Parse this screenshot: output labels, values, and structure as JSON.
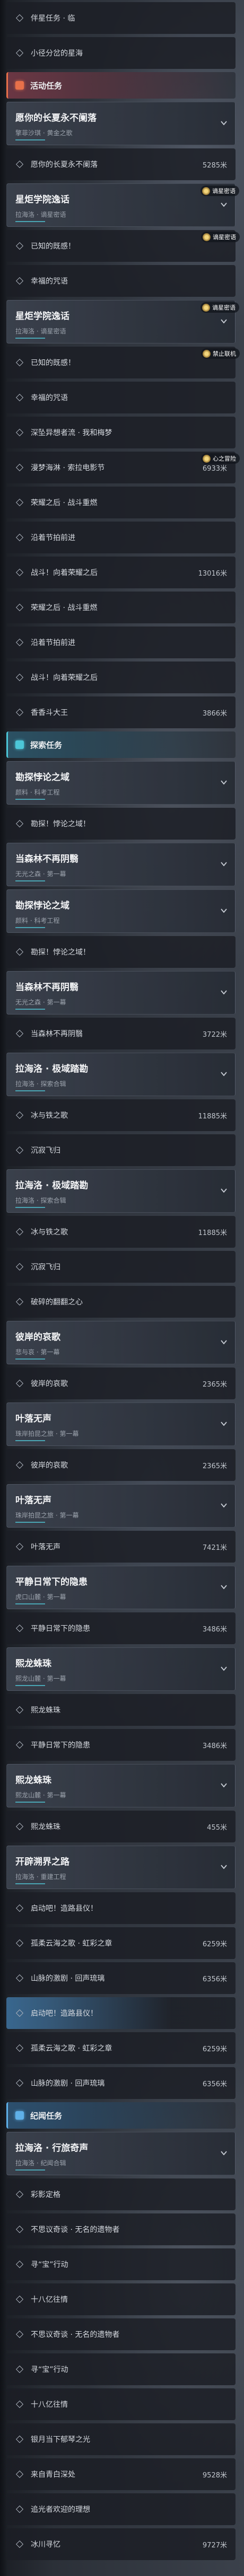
{
  "icons": {
    "item": "quest-bullet-icon",
    "group_toggle": "chevron-down-icon",
    "section": "quest-category-icon",
    "marker": "map-marker-icon"
  },
  "quest_list": {
    "rows": [
      {
        "type": "item",
        "label": "伴星任务 · 临"
      },
      {
        "type": "item",
        "label": "小径分岔的星海"
      },
      {
        "type": "section",
        "label": "活动任务",
        "accent": "#e8704a",
        "accent_bg": "rgba(120,58,72,.85)"
      },
      {
        "type": "group",
        "title": "愿你的长夏永不阑落",
        "subtitle": "擎菲沙琪 · 黄金之歌"
      },
      {
        "type": "item",
        "label": "愿你的长夏永不阑落",
        "distance": "5285米"
      },
      {
        "type": "group",
        "title": "星炬学院逸话",
        "subtitle": "拉海洛 · 谪星密语",
        "marker": {
          "label": "谪星密语"
        }
      },
      {
        "type": "item",
        "label": "已知的既感！",
        "marker": {
          "label": "谪星密语"
        }
      },
      {
        "type": "item",
        "label": "幸福的咒语"
      },
      {
        "type": "group",
        "title": "星炬学院逸话",
        "subtitle": "拉海洛 · 谪星密语",
        "marker": {
          "label": "谪星密语"
        }
      },
      {
        "type": "item",
        "label": "已知的既感！",
        "marker": {
          "label": "禁止联机"
        }
      },
      {
        "type": "item",
        "label": "幸福的咒语"
      },
      {
        "type": "item",
        "label": "深坠异想者流 · 我和梅梦"
      },
      {
        "type": "item",
        "label": "漫梦海淋 · 索拉电影节",
        "distance": "6933米",
        "marker": {
          "label": "心之冒险"
        }
      },
      {
        "type": "item",
        "label": "荣耀之后 · 战斗重燃"
      },
      {
        "type": "item",
        "label": "沿着节拍前进"
      },
      {
        "type": "item",
        "label": "战斗！向着荣耀之后",
        "distance": "13016米"
      },
      {
        "type": "item",
        "label": "荣耀之后 · 战斗重燃"
      },
      {
        "type": "item",
        "label": "沿着节拍前进"
      },
      {
        "type": "item",
        "label": "战斗！向着荣耀之后"
      },
      {
        "type": "item",
        "label": "香香斗大王",
        "distance": "3866米"
      },
      {
        "type": "section",
        "label": "探索任务",
        "accent": "#4cc6d8",
        "accent_bg": "rgba(45,88,108,.88)"
      },
      {
        "type": "group",
        "title": "勘探悖论之域",
        "subtitle": "颜料 · 科考工程"
      },
      {
        "type": "item",
        "label": "勘探！悖论之域！"
      },
      {
        "type": "group",
        "title": "当森林不再阴翳",
        "subtitle": "无光之森 · 第一幕"
      },
      {
        "type": "group",
        "title": "勘探悖论之域",
        "subtitle": "颜料 · 科考工程"
      },
      {
        "type": "item",
        "label": "勘探！悖论之域！"
      },
      {
        "type": "group",
        "title": "当森林不再阴翳",
        "subtitle": "无光之森 · 第一幕"
      },
      {
        "type": "item",
        "label": "当森林不再阴翳",
        "distance": "3722米"
      },
      {
        "type": "group",
        "title": "拉海洛 · 极域踏勘",
        "subtitle": "拉海洛 · 探索合辑"
      },
      {
        "type": "item",
        "label": "冰与铁之歌",
        "distance": "11885米"
      },
      {
        "type": "item",
        "label": "沉寂飞归"
      },
      {
        "type": "group",
        "title": "拉海洛 · 极域踏勘",
        "subtitle": "拉海洛 · 探索合辑"
      },
      {
        "type": "item",
        "label": "冰与铁之歌",
        "distance": "11885米"
      },
      {
        "type": "item",
        "label": "沉寂飞归"
      },
      {
        "type": "item",
        "label": "破碎的翻翻之心"
      },
      {
        "type": "group",
        "title": "彼岸的哀歌",
        "subtitle": "悲与哀 · 第一幕"
      },
      {
        "type": "item",
        "label": "彼岸的哀歌",
        "distance": "2365米"
      },
      {
        "type": "group",
        "title": "叶落无声",
        "subtitle": "珠岸拍昆之旅 · 第一幕"
      },
      {
        "type": "item",
        "label": "彼岸的哀歌",
        "distance": "2365米"
      },
      {
        "type": "group",
        "title": "叶落无声",
        "subtitle": "珠岸拍昆之旅 · 第一幕"
      },
      {
        "type": "item",
        "label": "叶落无声",
        "distance": "7421米"
      },
      {
        "type": "group",
        "title": "平静日常下的隐患",
        "subtitle": "虎口山麓 · 第一幕"
      },
      {
        "type": "item",
        "label": "平静日常下的隐患",
        "distance": "3486米"
      },
      {
        "type": "group",
        "title": "熙龙蛛珠",
        "subtitle": "熙龙山麓 · 第一幕"
      },
      {
        "type": "item",
        "label": "熙龙蛛珠"
      },
      {
        "type": "item",
        "label": "平静日常下的隐患",
        "distance": "3486米"
      },
      {
        "type": "group",
        "title": "熙龙蛛珠",
        "subtitle": "熙龙山麓 · 第一幕"
      },
      {
        "type": "item",
        "label": "熙龙蛛珠",
        "distance": "455米"
      },
      {
        "type": "group",
        "title": "开辟溯界之路",
        "subtitle": "拉海洛 · 重建工程"
      },
      {
        "type": "item",
        "label": "启动吧！造路县仪！"
      },
      {
        "type": "item",
        "label": "孤柔云海之歌 · 虹彩之章",
        "distance": "6259米"
      },
      {
        "type": "item",
        "label": "山脉的激剧 · 回声琉璃",
        "distance": "6356米"
      },
      {
        "type": "item",
        "label": "启动吧！造路县仪！",
        "highlight": true
      },
      {
        "type": "item",
        "label": "孤柔云海之歌 · 虹彩之章",
        "distance": "6259米"
      },
      {
        "type": "item",
        "label": "山脉的激剧 · 回声琉璃",
        "distance": "6356米"
      },
      {
        "type": "section",
        "label": "纪闻任务",
        "accent": "#5fb0e8",
        "accent_bg": "rgba(46,86,120,.88)"
      },
      {
        "type": "group",
        "title": "拉海洛 · 行旅奇声",
        "subtitle": "拉海洛 · 纪闻合辑"
      },
      {
        "type": "item",
        "label": "彩影定格"
      },
      {
        "type": "item",
        "label": "不思议奇谈 · 无名的遗物者"
      },
      {
        "type": "item",
        "label": "寻“宝”行动"
      },
      {
        "type": "item",
        "label": "十八亿往情"
      },
      {
        "type": "item",
        "label": "不思议奇谈 · 无名的遗物者"
      },
      {
        "type": "item",
        "label": "寻“宝”行动"
      },
      {
        "type": "item",
        "label": "十八亿往情"
      },
      {
        "type": "item",
        "label": "银月当下郁琴之光"
      },
      {
        "type": "item",
        "label": "来自青白深处",
        "distance": "9528米"
      },
      {
        "type": "item",
        "label": "追光者欢迎的理想"
      },
      {
        "type": "item",
        "label": "冰川寻忆",
        "distance": "9727米"
      }
    ]
  }
}
